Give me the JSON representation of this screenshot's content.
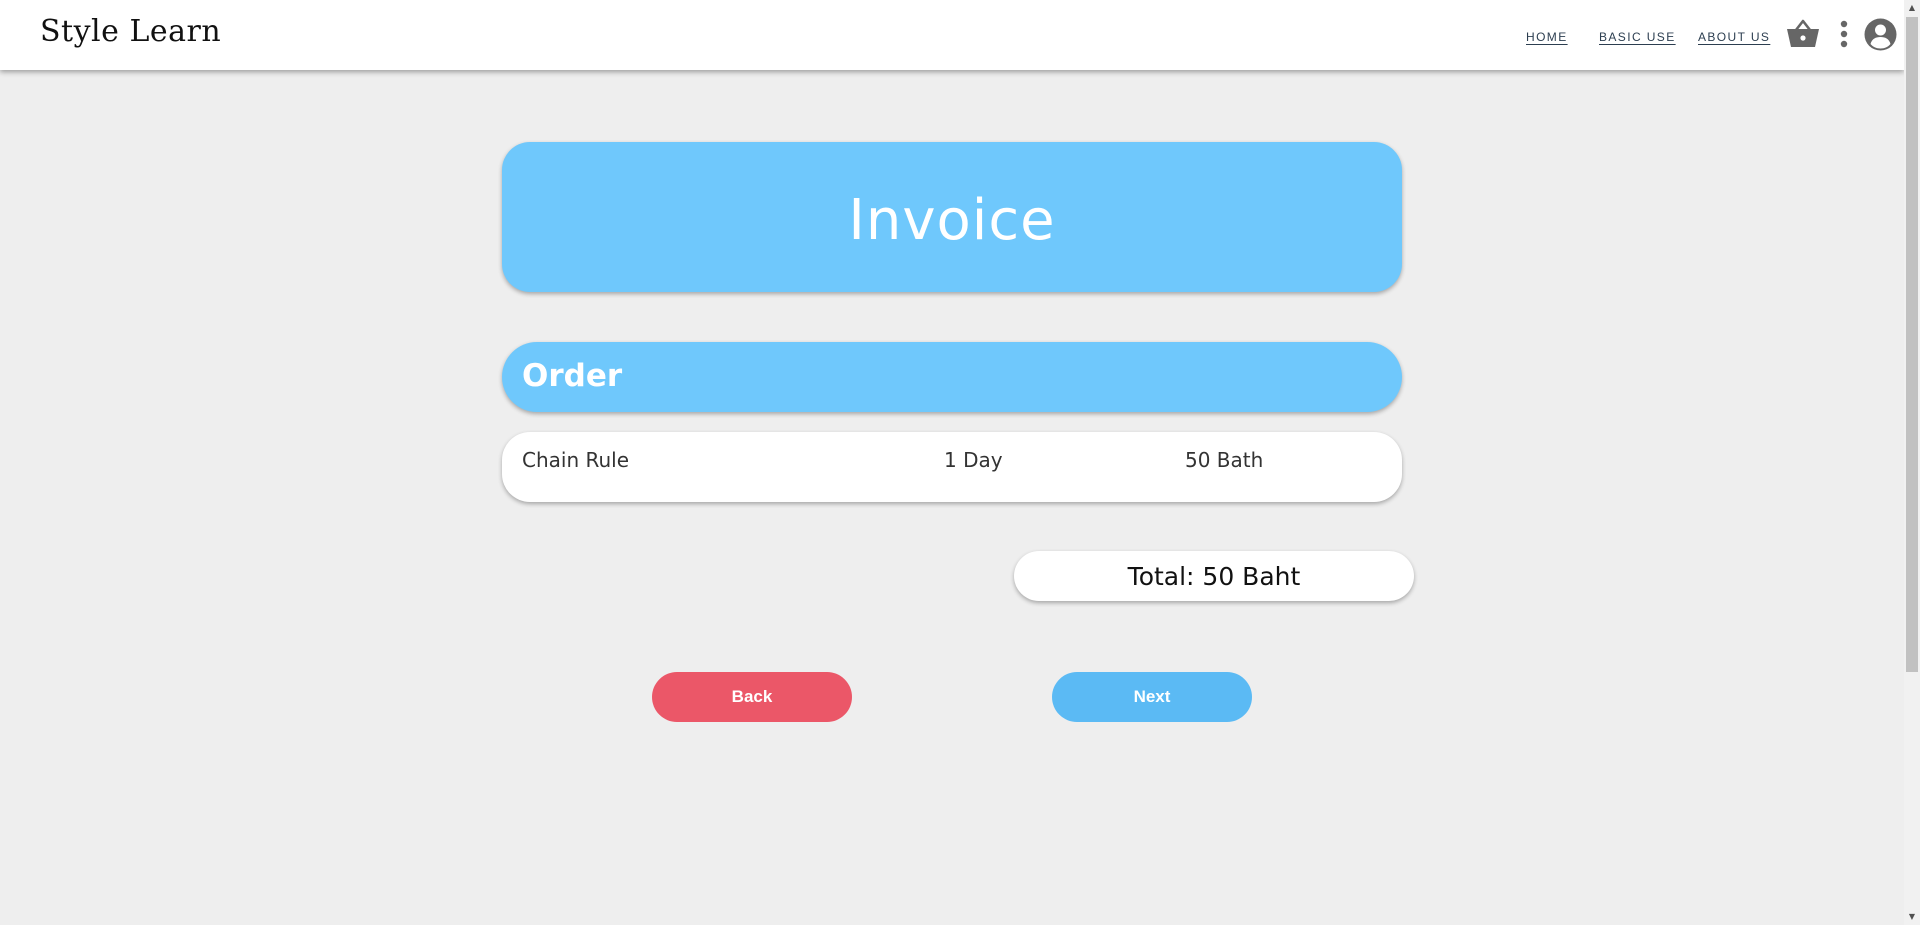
{
  "header": {
    "logo": "Style Learn",
    "nav": [
      {
        "label": "HOME"
      },
      {
        "label": "BASIC USE"
      },
      {
        "label": "ABOUT US"
      }
    ],
    "icons": [
      "basket-icon",
      "more-vert-icon",
      "account-circle-icon"
    ]
  },
  "invoice": {
    "title": "Invoice",
    "order_heading": "Order",
    "items": [
      {
        "name": "Chain Rule",
        "duration": "1 Day",
        "price": "50 Bath"
      }
    ],
    "total": "Total: 50 Baht"
  },
  "actions": {
    "back_label": "Back",
    "next_label": "Next"
  },
  "colors": {
    "card_blue": "#6fc8fc",
    "back_red": "#eb5768",
    "next_blue": "#5bbaf4",
    "background": "#eeeeee"
  }
}
